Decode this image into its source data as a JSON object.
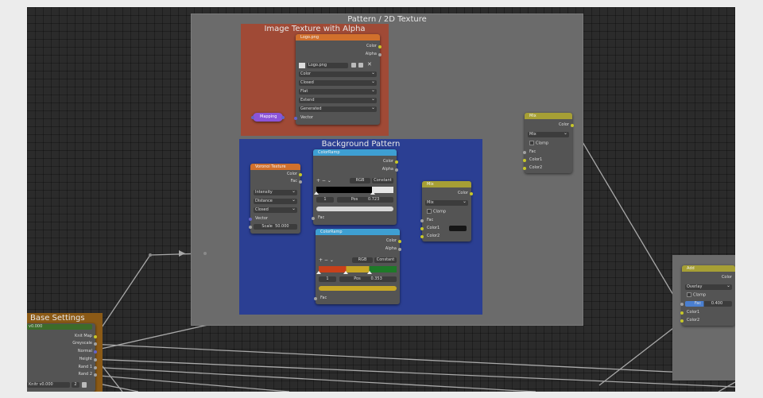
{
  "frames": {
    "pattern": "Pattern / 2D Texture",
    "image_texture": "Image Texture with Alpha",
    "background": "Background Pattern",
    "base": "Base Settings"
  },
  "image_node": {
    "title": "Logo.png",
    "outputs": [
      "Color",
      "Alpha"
    ],
    "filename": "Logo.png",
    "dropdowns": [
      "Color",
      "Closed",
      "Flat",
      "Extend",
      "Generated"
    ],
    "input": "Vector"
  },
  "mapping_node": {
    "title": "Mapping"
  },
  "voronoi": {
    "title": "Voronoi Texture",
    "outputs": [
      "Color",
      "Fac"
    ],
    "dropdowns": [
      "Intensity",
      "Distance",
      "Closed"
    ],
    "input": "Vector",
    "scale_label": "Scale",
    "scale_value": "50.000"
  },
  "ramp1": {
    "title": "ColorRamp",
    "outputs": [
      "Color",
      "Alpha"
    ],
    "tools": "+   −   ⌄",
    "mode": "RGB",
    "interp": "Constant",
    "index": "1",
    "pos_label": "Pos",
    "pos_value": "0.723",
    "input": "Fac"
  },
  "ramp2": {
    "title": "ColorRamp",
    "outputs": [
      "Color",
      "Alpha"
    ],
    "tools": "+   −   ⌄",
    "mode": "RGB",
    "interp": "Constant",
    "index": "1",
    "pos_label": "Pos",
    "pos_value": "0.353",
    "input": "Fac"
  },
  "mix_inner": {
    "title": "Mix",
    "output": "Color",
    "mode": "Mix",
    "clamp": "Clamp",
    "inputs": [
      "Fac",
      "Color1",
      "Color2"
    ]
  },
  "mix_right": {
    "title": "Mix",
    "output": "Color",
    "mode": "Mix",
    "clamp": "Clamp",
    "inputs": [
      "Fac",
      "Color1",
      "Color2"
    ]
  },
  "add_node": {
    "title": "Add",
    "output": "Color",
    "mode": "Overlay",
    "clamp": "Clamp",
    "fac_label": "Fac",
    "fac_value": "0.400",
    "inputs": [
      "Color1",
      "Color2"
    ]
  },
  "base_node": {
    "value_field": "v0.000",
    "outputs": [
      "Knit Map",
      "Greyscale",
      "Normal",
      "Height",
      "Rand 1",
      "Rand 2"
    ],
    "bottom_field": "Knitr v0.000",
    "bottom_num": "2"
  },
  "colors": {
    "texture_header": "#d1702c",
    "converter_header": "#3e9fd2",
    "mix_header": "#a69f35",
    "vector_header": "#8b54d8",
    "socket_color": "#c7c729",
    "socket_float": "#a1a1a1",
    "socket_vector": "#6363c7"
  },
  "icons": [
    "image-icon",
    "folder-icon",
    "close-icon",
    "reroute-arrow-icon"
  ]
}
